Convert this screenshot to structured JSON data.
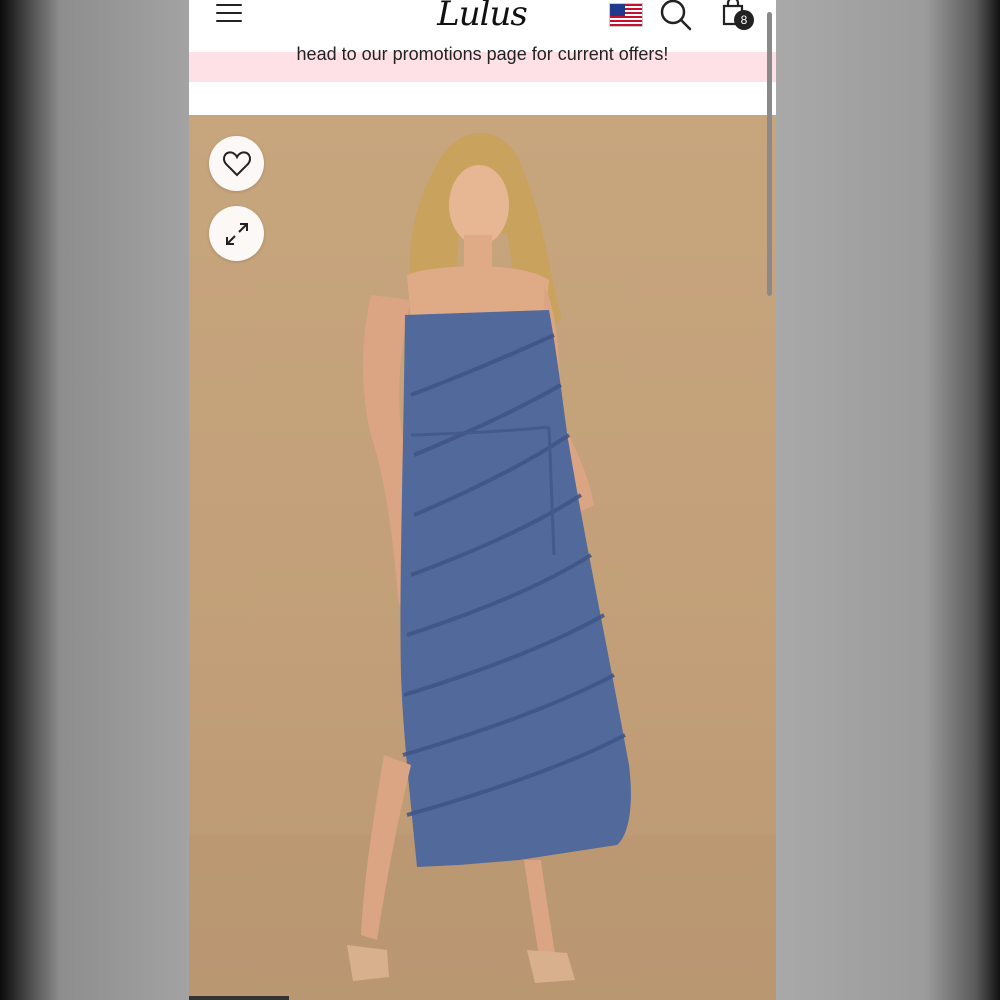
{
  "page": {
    "brand": "Lulus",
    "promo_text": "head to our promotions page for current offers!",
    "cart_count": "8",
    "icons": {
      "menu": "hamburger-menu-icon",
      "flag": "us-flag-icon",
      "search": "search-icon",
      "cart": "shopping-bag-icon",
      "favorite": "heart-icon",
      "expand": "expand-icon"
    },
    "colors": {
      "promo_bg": "#fde1e6",
      "image_bg": "#c7a57d",
      "dress": "#52699c"
    }
  }
}
